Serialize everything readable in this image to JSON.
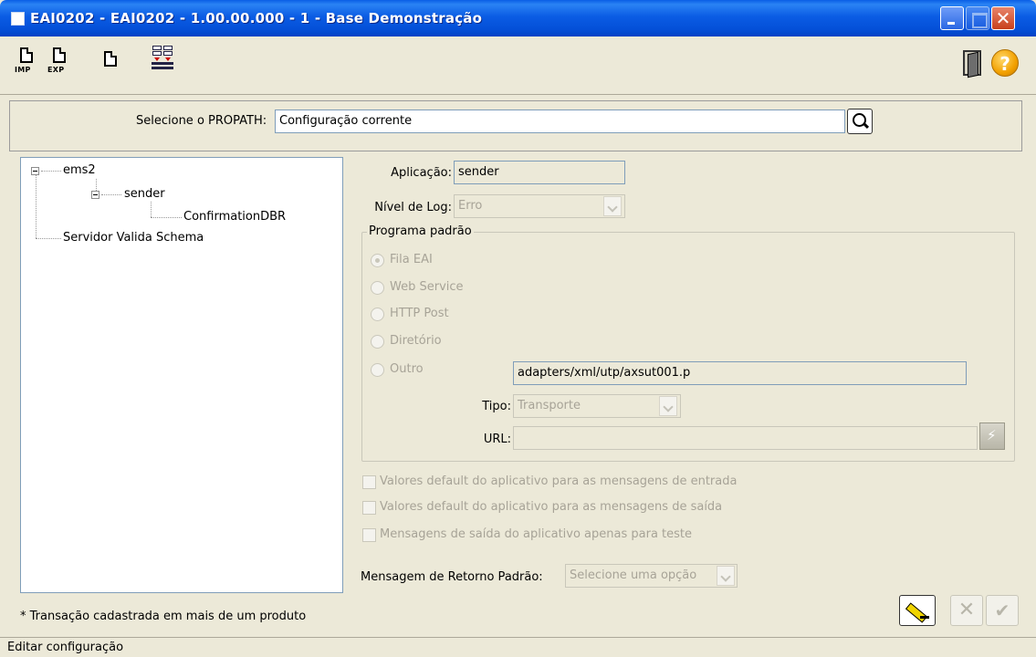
{
  "window": {
    "title": "EAI0202 - EAI0202 - 1.00.00.000 - 1 - Base Demonstração",
    "close_glyph": "✕"
  },
  "toolbar": {
    "import_label": "IMP",
    "export_label": "EXP",
    "help_glyph": "?"
  },
  "propath": {
    "label": "Selecione o PROPATH:",
    "value": "Configuração corrente"
  },
  "tree": {
    "nodes": [
      {
        "label": "ems2"
      },
      {
        "label": "sender"
      },
      {
        "label": "ConfirmationDBR"
      },
      {
        "label": "Servidor Valida Schema"
      }
    ]
  },
  "form": {
    "aplicacao_label": "Aplicação:",
    "aplicacao_value": "sender",
    "nivel_log_label": "Nível de Log:",
    "nivel_log_value": "Erro",
    "programa_padrao_title": "Programa padrão",
    "radios": [
      {
        "label": "Fila EAI",
        "selected": true
      },
      {
        "label": "Web Service",
        "selected": false
      },
      {
        "label": "HTTP Post",
        "selected": false
      },
      {
        "label": "Diretório",
        "selected": false
      },
      {
        "label": "Outro",
        "selected": false
      }
    ],
    "outro_value": "adapters/xml/utp/axsut001.p",
    "tipo_label": "Tipo:",
    "tipo_value": "Transporte",
    "url_label": "URL:",
    "url_value": "",
    "checkboxes": [
      {
        "label": "Valores default do aplicativo para as mensagens de entrada",
        "checked": false
      },
      {
        "label": "Valores default do aplicativo para as mensagens de saída",
        "checked": false
      },
      {
        "label": "Mensagens de saída do aplicativo apenas para teste",
        "checked": false
      }
    ],
    "retorno_label": "Mensagem de Retorno Padrão:",
    "retorno_value": "Selecione uma opção"
  },
  "footer": {
    "note": "* Transação cadastrada em mais de um produto",
    "cancel_glyph": "✕",
    "ok_glyph": "✔"
  },
  "status": {
    "text": "Editar configuração"
  }
}
